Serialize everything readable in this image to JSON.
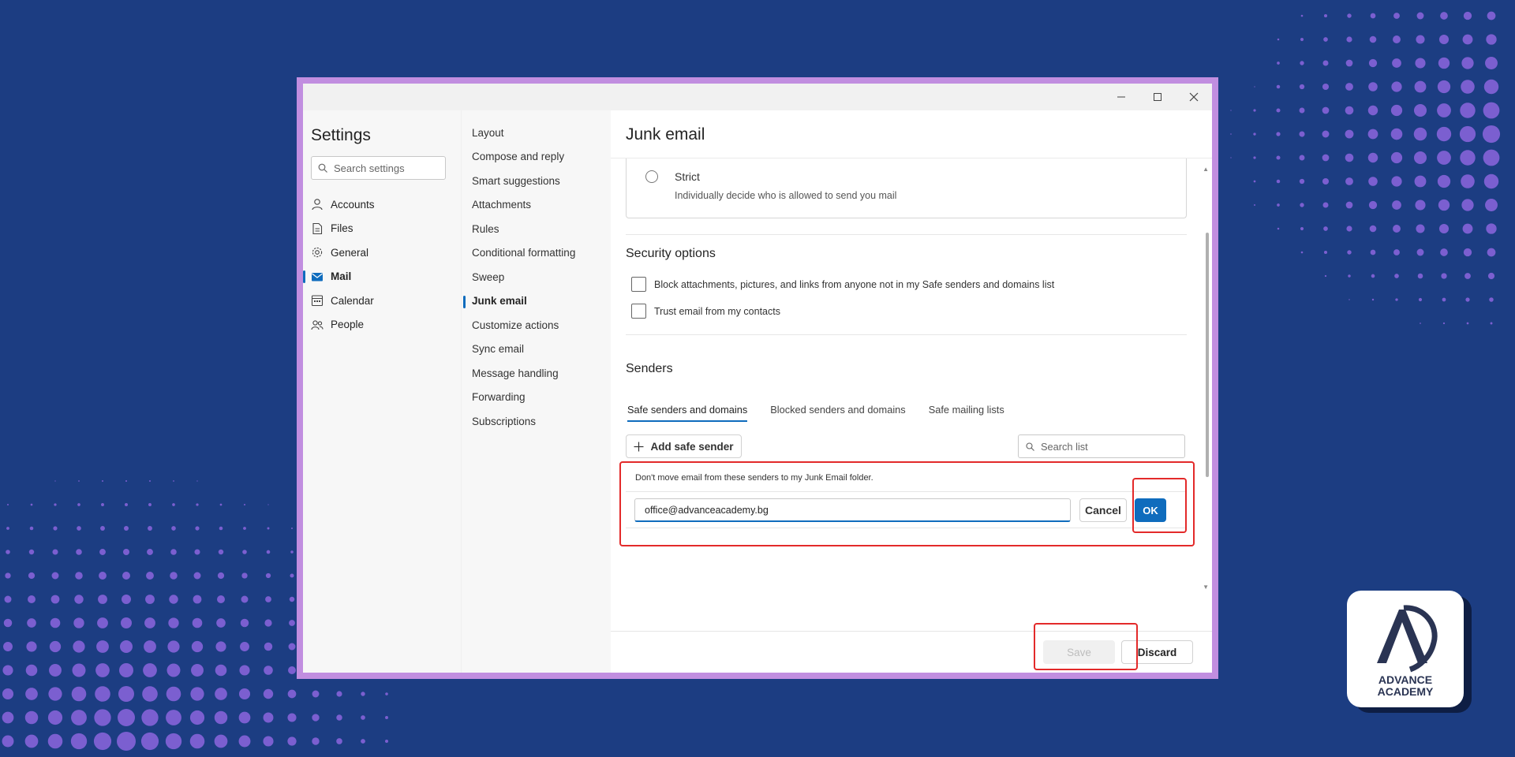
{
  "window": {
    "controls": [
      "minimize",
      "maximize",
      "close"
    ]
  },
  "nav": {
    "title": "Settings",
    "search_placeholder": "Search settings",
    "items": [
      {
        "label": "Accounts",
        "icon": "person-icon"
      },
      {
        "label": "Files",
        "icon": "file-icon"
      },
      {
        "label": "General",
        "icon": "gear-icon"
      },
      {
        "label": "Mail",
        "icon": "mail-icon",
        "active": true
      },
      {
        "label": "Calendar",
        "icon": "calendar-icon"
      },
      {
        "label": "People",
        "icon": "people-icon"
      }
    ]
  },
  "subnav": {
    "items": [
      "Layout",
      "Compose and reply",
      "Smart suggestions",
      "Attachments",
      "Rules",
      "Conditional formatting",
      "Sweep",
      "Junk email",
      "Customize actions",
      "Sync email",
      "Message handling",
      "Forwarding",
      "Subscriptions"
    ],
    "active": "Junk email"
  },
  "content": {
    "title": "Junk email",
    "strict": {
      "label": "Strict",
      "description": "Individually decide who is allowed to send you mail"
    },
    "security": {
      "heading": "Security options",
      "options": [
        "Block attachments, pictures, and links from anyone not in my Safe senders and domains list",
        "Trust email from my contacts"
      ]
    },
    "senders": {
      "heading": "Senders",
      "tabs": [
        "Safe senders and domains",
        "Blocked senders and domains",
        "Safe mailing lists"
      ],
      "active_tab": "Safe senders and domains",
      "add_button": "Add safe sender",
      "search_placeholder": "Search list",
      "hint": "Don't move email from these senders to my Junk Email folder.",
      "input_value": "office@advanceacademy.bg",
      "cancel_label": "Cancel",
      "ok_label": "OK"
    },
    "footer": {
      "save_label": "Save",
      "discard_label": "Discard"
    }
  },
  "logo": {
    "line1": "ADVANCE",
    "line2": "ACADEMY"
  },
  "colors": {
    "background": "#1c3d82",
    "dots": "#7b5fd0",
    "frame": "#c18ee0",
    "accent": "#0f6cbd",
    "highlight": "#e32a2a"
  }
}
